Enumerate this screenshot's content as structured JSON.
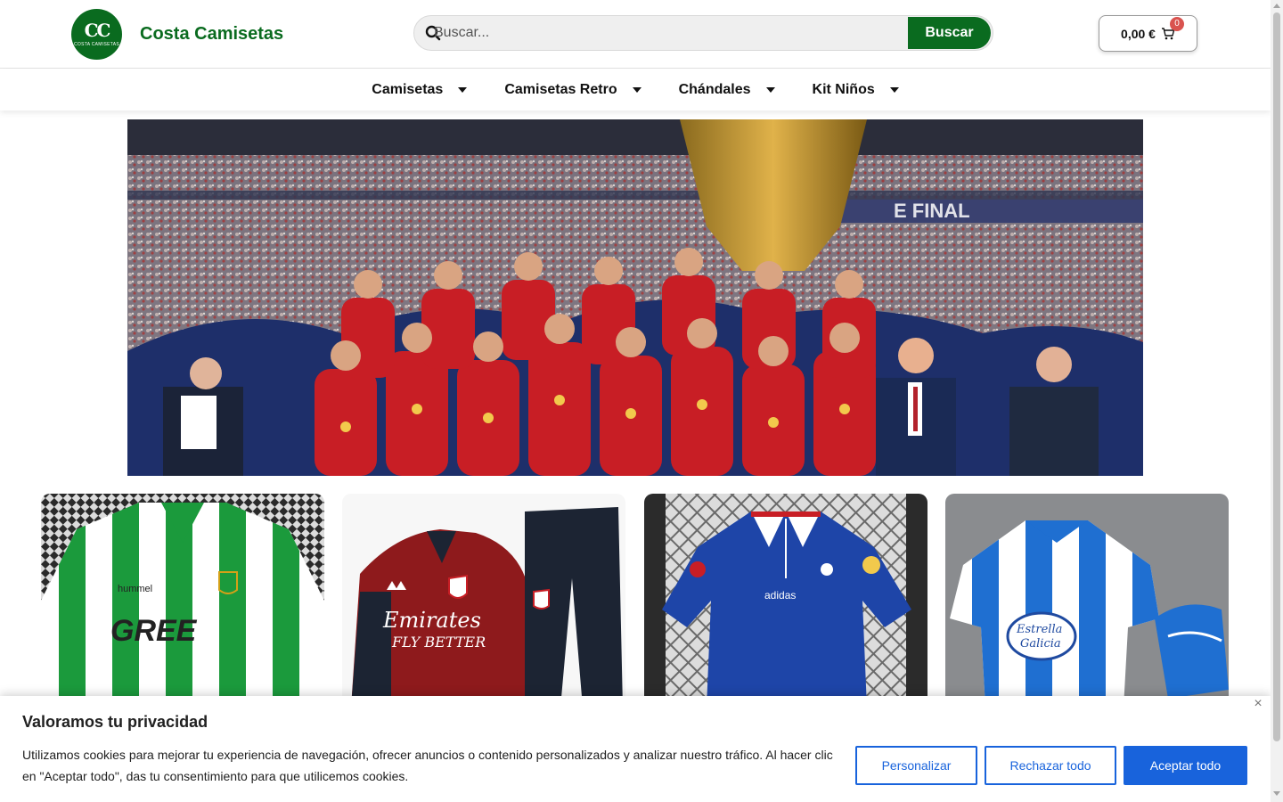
{
  "header": {
    "logo_text": "CC",
    "logo_subtext": "COSTA CAMISETAS",
    "brand": "Costa Camisetas",
    "search_placeholder": "Buscar...",
    "search_button": "Buscar",
    "cart_total": "0,00 €",
    "cart_count": "0"
  },
  "nav": {
    "items": [
      {
        "label": "Camisetas"
      },
      {
        "label": "Camisetas Retro"
      },
      {
        "label": "Chándales"
      },
      {
        "label": "Kit Niños"
      }
    ]
  },
  "products": [
    {
      "name": "betis-jersey",
      "primary": "#1b9a3c",
      "secondary": "#ffffff",
      "sponsor": "GREE",
      "brand_mark": "hummel"
    },
    {
      "name": "arsenal-tracksuit",
      "primary": "#8e1a1c",
      "secondary": "#1c2433",
      "sponsor": "Emirates",
      "sponsor_line2": "FLY BETTER"
    },
    {
      "name": "france-retro-jersey",
      "primary": "#1e45a8",
      "secondary": "#ffffff",
      "brand_mark": "adidas"
    },
    {
      "name": "deportivo-kids-kit",
      "primary": "#1f6fd1",
      "secondary": "#ffffff",
      "sponsor": "Estrella",
      "sponsor_line2": "Galicia"
    }
  ],
  "cookie": {
    "title": "Valoramos tu privacidad",
    "text": "Utilizamos cookies para mejorar tu experiencia de navegación, ofrecer anuncios o contenido personalizados y analizar nuestro tráfico. Al hacer clic en \"Aceptar todo\", das tu consentimiento para que utilicemos cookies.",
    "customize": "Personalizar",
    "reject": "Rechazar todo",
    "accept": "Aceptar todo",
    "close": "×"
  },
  "colors": {
    "brand_green": "#0a6b1f",
    "accent_blue": "#1863dc",
    "badge_red": "#d9534f"
  }
}
